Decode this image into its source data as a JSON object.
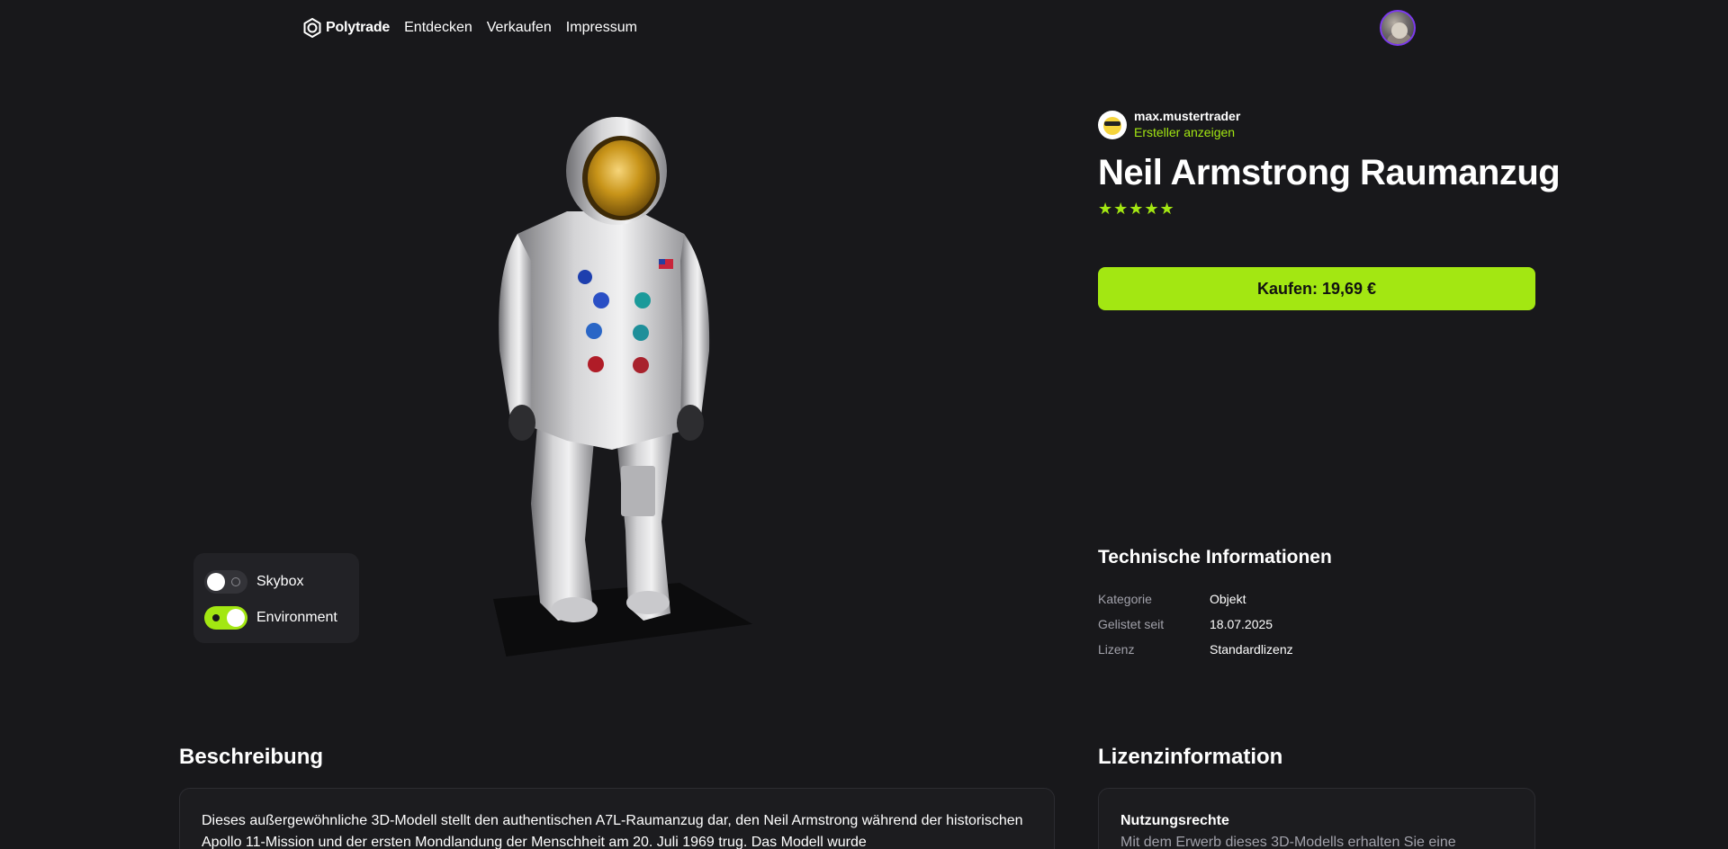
{
  "header": {
    "brand": "Polytrade",
    "nav": [
      "Entdecken",
      "Verkaufen",
      "Impressum"
    ]
  },
  "viewer": {
    "toggles": [
      {
        "label": "Skybox",
        "on": false
      },
      {
        "label": "Environment",
        "on": true
      }
    ]
  },
  "product": {
    "creator_name": "max.mustertrader",
    "creator_link": "Ersteller anzeigen",
    "title": "Neil Armstrong Raumanzug",
    "stars": "★★★★★",
    "rating": 5,
    "buy_label": "Kaufen: 19,69 €"
  },
  "tech": {
    "title": "Technische Informationen",
    "rows": [
      {
        "key": "Kategorie",
        "value": "Objekt"
      },
      {
        "key": "Gelistet seit",
        "value": "18.07.2025"
      },
      {
        "key": "Lizenz",
        "value": "Standardlizenz"
      }
    ]
  },
  "description": {
    "title": "Beschreibung",
    "text": "Dieses außergewöhnliche 3D-Modell stellt den authentischen A7L-Raumanzug dar, den Neil Armstrong während der historischen Apollo 11-Mission und der ersten Mondlandung der Menschheit am 20. Juli 1969 trug. Das Modell wurde"
  },
  "license": {
    "title": "Lizenzinformation",
    "heading": "Nutzungsrechte",
    "text": "Mit dem Erwerb dieses 3D-Modells erhalten Sie eine"
  },
  "colors": {
    "background": "#18181b",
    "accent": "#a3e712",
    "avatar_border": "#7c3aed"
  }
}
